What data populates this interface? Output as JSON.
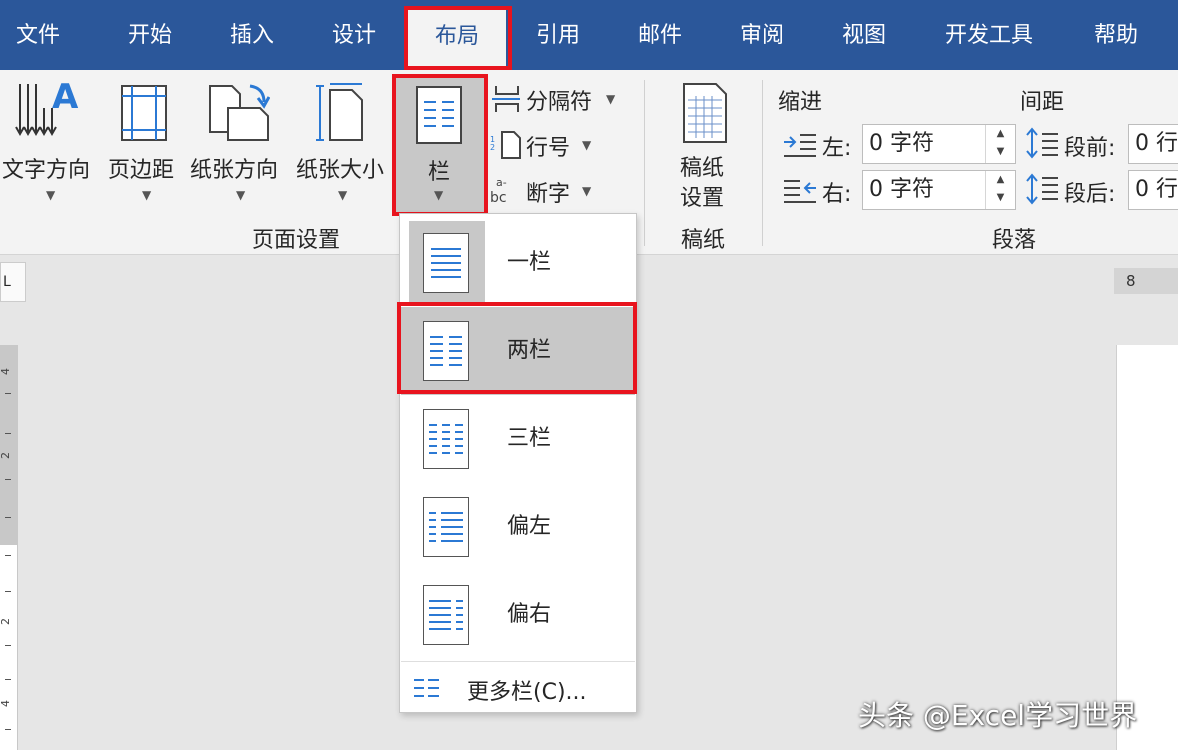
{
  "tabs": [
    {
      "label": "文件"
    },
    {
      "label": "开始"
    },
    {
      "label": "插入"
    },
    {
      "label": "设计"
    },
    {
      "label": "布局"
    },
    {
      "label": "引用"
    },
    {
      "label": "邮件"
    },
    {
      "label": "审阅"
    },
    {
      "label": "视图"
    },
    {
      "label": "开发工具"
    },
    {
      "label": "帮助"
    }
  ],
  "ribbon": {
    "page_setup": {
      "group_label": "页面设置",
      "text_direction": "文字方向",
      "margins": "页边距",
      "orientation": "纸张方向",
      "size": "纸张大小",
      "columns": "栏",
      "breaks": "分隔符",
      "line_numbers": "行号",
      "hyphenation": "断字"
    },
    "manuscript": {
      "group_label": "稿纸",
      "button_line1": "稿纸",
      "button_line2": "设置"
    },
    "paragraph": {
      "group_label": "段落",
      "indent_title": "缩进",
      "spacing_title": "间距",
      "left_label": "左:",
      "right_label": "右:",
      "before_label": "段前:",
      "after_label": "段后:",
      "left_value": "0 字符",
      "right_value": "0 字符",
      "before_value": "0 行",
      "after_value": "0 行"
    }
  },
  "columns_menu": {
    "items": [
      {
        "label": "一栏"
      },
      {
        "label": "两栏"
      },
      {
        "label": "三栏"
      },
      {
        "label": "偏左"
      },
      {
        "label": "偏右"
      }
    ],
    "more": "更多栏(C)..."
  },
  "ruler": {
    "h_number": "8",
    "corner": "L",
    "v_numbers": [
      "4",
      "2",
      "2",
      "4"
    ]
  },
  "watermark": "头条 @Excel学习世界",
  "colors": {
    "accent": "#2b579a",
    "highlight": "#e8141e",
    "selected": "#c8c8c8"
  }
}
